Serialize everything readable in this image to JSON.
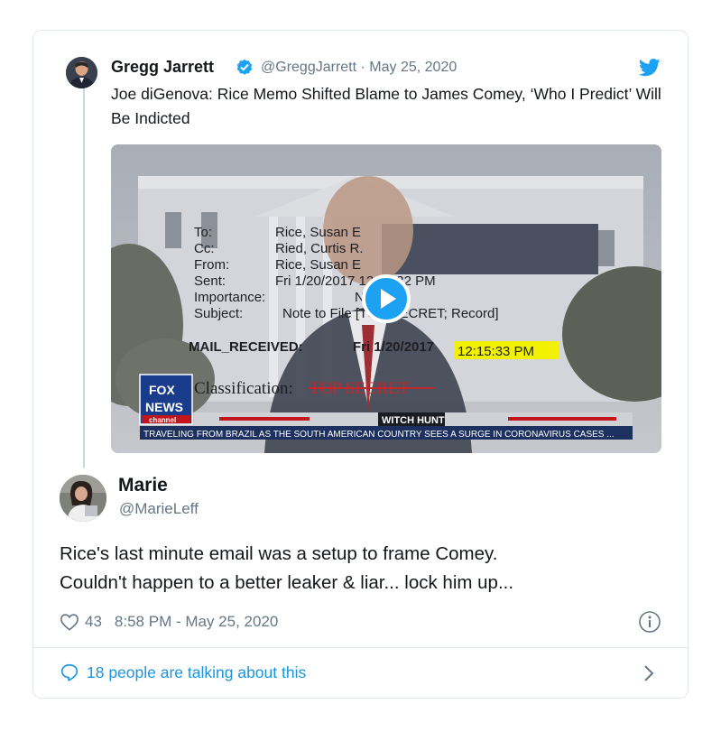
{
  "quoted_tweet": {
    "author_name": "Gregg Jarrett",
    "handle": "@GreggJarrett",
    "separator": "·",
    "date": "May 25, 2020",
    "text": "Joe diGenova: Rice Memo Shifted Blame to James Comey, ‘Who I Predict’ Will Be Indicted"
  },
  "video": {
    "memo_labels": [
      "To:",
      "Cc:",
      "From:",
      "Sent:",
      "Importance:",
      "Subject:",
      "MAIL_RECEIVED:"
    ],
    "memo_values": [
      "Rice, Susan E",
      "Ried, Curtis R.",
      "Rice, Susan E",
      "Fri 1/20/2017 12:15:32 PM",
      "N",
      "Note to File [TOP SECRET; Record]",
      "Fri 1/20/2017"
    ],
    "memo_time_highlight": "12:15:33 PM",
    "classification_label": "Classification:",
    "classification_value": "TOP SECRET",
    "logo_top": "FOX",
    "logo_middle": "NEWS",
    "logo_bottom": "channel",
    "bar_text": "WITCH HUNT",
    "ticker": "TRAVELING FROM BRAZIL AS THE SOUTH AMERICAN COUNTRY SEES A SURGE IN CORONAVIRUS CASES ..."
  },
  "main_tweet": {
    "author_name": "Marie",
    "handle": "@MarieLeff",
    "text_line1": "Rice's last minute email was a setup to frame Comey.",
    "text_line2": "Couldn't happen to a better leaker & liar... lock him up...",
    "likes": "43",
    "timestamp": "8:58 PM - May 25, 2020"
  },
  "footer": {
    "talking": "18 people are talking about this"
  },
  "colors": {
    "accent_blue": "#1da1f2",
    "link_blue": "#1b95e0",
    "secondary_gray": "#657786",
    "border": "#e1e8ed",
    "highlight_yellow": "#f2f200"
  }
}
